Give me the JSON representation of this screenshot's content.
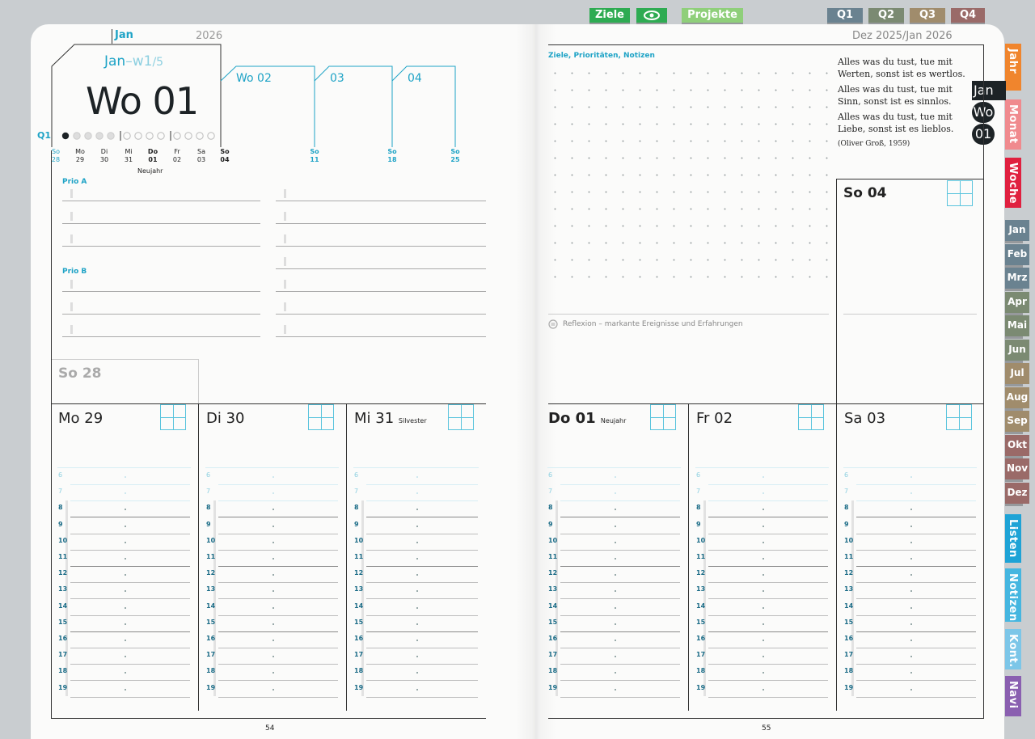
{
  "top_tabs": [
    {
      "label": "Ziele",
      "color": "#2eab52"
    },
    {
      "label": "eye",
      "color": "#2eab52"
    },
    {
      "label": "Projekte",
      "color": "#8fcf7a"
    },
    {
      "label": "Q1",
      "color": "#6a8290"
    },
    {
      "label": "Q2",
      "color": "#7b8a72"
    },
    {
      "label": "Q3",
      "color": "#a08c6c"
    },
    {
      "label": "Q4",
      "color": "#9a6a68"
    }
  ],
  "side_tabs_vertical": [
    {
      "label": "Jahr",
      "color": "#f0852d"
    },
    {
      "label": "Monat",
      "color": "#f08a8e"
    },
    {
      "label": "Woche",
      "color": "#e0203f"
    }
  ],
  "month_tabs": [
    "Jan",
    "Feb",
    "Mrz",
    "Apr",
    "Mai",
    "Jun",
    "Jul",
    "Aug",
    "Sep",
    "Okt",
    "Nov",
    "Dez"
  ],
  "side_tabs_bottom": [
    {
      "label": "Listen",
      "color": "#1ea3d6"
    },
    {
      "label": "Notizen",
      "color": "#45b6e0"
    },
    {
      "label": "Kont.",
      "color": "#7cc6e8"
    },
    {
      "label": "Navi",
      "color": "#8a5fb0"
    }
  ],
  "nav_markers": {
    "month": "Jan",
    "wo": "Wo",
    "week": "01"
  },
  "left": {
    "month_label": "Jan",
    "year": "2026",
    "jan_w": "Jan",
    "w_sep": "–w1",
    "w_total": "/5",
    "week_title": "Wo 01",
    "q_label": "Q1",
    "week_tabs": [
      "Wo 02",
      "03",
      "04"
    ],
    "days": [
      {
        "d": "So",
        "n": "28",
        "cyan": true
      },
      {
        "d": "Mo",
        "n": "29"
      },
      {
        "d": "Di",
        "n": "30"
      },
      {
        "d": "Mi",
        "n": "31"
      },
      {
        "d": "Do",
        "n": "01",
        "bold": true
      },
      {
        "d": "Fr",
        "n": "02"
      },
      {
        "d": "Sa",
        "n": "03"
      },
      {
        "d": "So",
        "n": "04",
        "bold": true
      }
    ],
    "sundays": [
      {
        "d": "So",
        "n": "11"
      },
      {
        "d": "So",
        "n": "18"
      },
      {
        "d": "So",
        "n": "25"
      }
    ],
    "holiday": "Neujahr",
    "prio_a": "Prio A",
    "prio_b": "Prio B",
    "so28": "So 28",
    "columns": [
      {
        "title": "Mo 29",
        "note": ""
      },
      {
        "title": "Di 30",
        "note": ""
      },
      {
        "title": "Mi 31",
        "note": "Silvester"
      }
    ],
    "page_number": "54"
  },
  "right": {
    "header": "Dez 2025/Jan 2026",
    "goals_label": "Ziele, Prioritäten, Notizen",
    "quotes": [
      "Alles was du tust, tue mit Werten, sonst ist es wertlos.",
      "Alles was du tust, tue mit Sinn, sonst ist es sinnlos.",
      "Alles was du tust, tue mit Liebe, sonst ist es lieblos."
    ],
    "quote_author": "(Oliver Groß, 1959)",
    "so04": "So 04",
    "reflexion": "Reflexion – markante Ereignisse und Erfahrungen",
    "columns": [
      {
        "title": "Do 01",
        "note": "Neujahr",
        "bold": true
      },
      {
        "title": "Fr 02",
        "note": ""
      },
      {
        "title": "Sa 03",
        "note": ""
      }
    ],
    "page_number": "55"
  },
  "hours": [
    "6",
    "7",
    "8",
    "9",
    "10",
    "11",
    "12",
    "13",
    "14",
    "15",
    "16",
    "17",
    "18",
    "19"
  ]
}
